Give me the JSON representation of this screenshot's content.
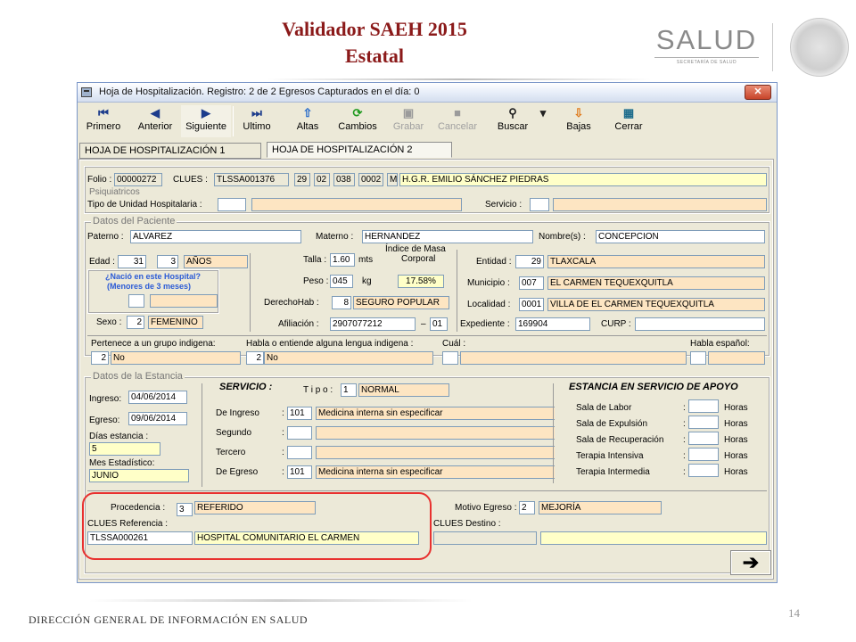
{
  "slide": {
    "title_line1": "Validador SAEH 2015",
    "title_line2": "Estatal",
    "logo_text": "SALUD",
    "logo_subtitle": "SECRETARÍA DE SALUD",
    "footer": "DIRECCIÓN GENERAL DE INFORMACIÓN EN SALUD",
    "page_number": "14"
  },
  "window": {
    "title": "Hoja de Hospitalización. Registro: 2 de 2    Egresos Capturados en el día: 0",
    "close_glyph": "✕"
  },
  "toolbar": [
    {
      "label": "Primero",
      "glyph": "⏮",
      "enabled": true
    },
    {
      "label": "Anterior",
      "glyph": "◀",
      "enabled": true
    },
    {
      "label": "Siguiente",
      "glyph": "▶",
      "enabled": true
    },
    {
      "label": "Ultimo",
      "glyph": "⏭",
      "enabled": true
    },
    {
      "label": "Altas",
      "glyph": "⇧",
      "enabled": true
    },
    {
      "label": "Cambios",
      "glyph": "⟳",
      "enabled": true
    },
    {
      "label": "Grabar",
      "glyph": "▣",
      "enabled": false
    },
    {
      "label": "Cancelar",
      "glyph": "■",
      "enabled": false
    },
    {
      "label": "Buscar",
      "glyph": "⚲",
      "enabled": true
    },
    {
      "label": "Bajas",
      "glyph": "⇩",
      "enabled": true
    },
    {
      "label": "Cerrar",
      "glyph": "▦",
      "enabled": true
    }
  ],
  "toolbar_dropdown": "▾",
  "tabs": [
    "HOJA DE HOSPITALIZACIÓN 1",
    "HOJA DE HOSPITALIZACIÓN 2"
  ],
  "form": {
    "folio_label": "Folio :",
    "folio": "00000272",
    "clues_label": "CLUES :",
    "clues": "TLSSA001376",
    "d1": "29",
    "d2": "02",
    "d3": "038",
    "d4": "0002",
    "d5": "M",
    "hospital": "H.G.R. EMILIO SÁNCHEZ PIEDRAS",
    "psiquiatricos": "Psiquiatricos",
    "tipo_unidad_label": "Tipo de Unidad Hospitalaria :",
    "servicio_label": "Servicio :",
    "datos_paciente": "Datos del Paciente",
    "paterno_label": "Paterno :",
    "paterno": "ALVAREZ",
    "materno_label": "Materno :",
    "materno": "HERNANDEZ",
    "nombres_label": "Nombre(s) :",
    "nombres": "CONCEPCION",
    "edad_label": "Edad :",
    "edad": "31",
    "edad_code": "3",
    "edad_unit": "AÑOS",
    "nacio_q1": "¿Nació en este Hospital?",
    "nacio_q2": "(Menores de 3 meses)",
    "sexo_label": "Sexo :",
    "sexo_code": "2",
    "sexo": "FEMENINO",
    "talla_label": "Talla :",
    "talla": "1.60",
    "talla_unit": "mts",
    "imc_label1": "Índice de Masa",
    "imc_label2": "Corporal",
    "imc": "17.58%",
    "peso_label": "Peso :",
    "peso": "045",
    "peso_unit": "kg",
    "derechohab_label": "DerechoHab :",
    "derechohab_code": "8",
    "derechohab": "SEGURO POPULAR",
    "afiliacion_label": "Afiliación :",
    "afiliacion": "2907077212",
    "afiliacion_sep": "–",
    "afiliacion_b": "01",
    "entidad_label": "Entidad :",
    "entidad_code": "29",
    "entidad": "TLAXCALA",
    "municipio_label": "Municipio :",
    "municipio_code": "007",
    "municipio": "EL CARMEN TEQUEXQUITLA",
    "localidad_label": "Localidad :",
    "localidad_code": "0001",
    "localidad": "VILLA DE EL CARMEN TEQUEXQUITLA",
    "expediente_label": "Expediente :",
    "expediente": "169904",
    "curp_label": "CURP :",
    "indigena_label": "Pertenece a un grupo indigena:",
    "indigena_code": "2",
    "indigena": "No",
    "lengua_label": "Habla o entiende alguna lengua indigena :",
    "lengua_code": "2",
    "lengua": "No",
    "cual_label": "Cuál :",
    "espanol_label": "Habla español:",
    "datos_estancia": "Datos de la Estancia",
    "ingreso_label": "Ingreso:",
    "ingreso": "04/06/2014",
    "egreso_label": "Egreso:",
    "egreso": "09/06/2014",
    "dias_label": "Días estancia :",
    "dias": "5",
    "mes_label": "Mes Estadístico:",
    "mes": "JUNIO",
    "servicio_title": "SERVICIO :",
    "tipo_label": "T i p o :",
    "tipo_code": "1",
    "tipo": "NORMAL",
    "de_ingreso_label": "De Ingreso",
    "de_ingreso_code": "101",
    "de_ingreso": "Medicina interna sin especificar",
    "segundo_label": "Segundo",
    "tercero_label": "Tercero",
    "de_egreso_label": "De Egreso",
    "de_egreso_code": "101",
    "de_egreso": "Medicina interna sin especificar",
    "colon": ":",
    "estancia_title": "ESTANCIA EN SERVICIO DE APOYO",
    "apoyo": [
      "Sala de Labor",
      "Sala de Expulsión",
      "Sala de Recuperación",
      "Terapia Intensiva",
      "Terapia Intermedia"
    ],
    "horas": "Horas",
    "procedencia_label": "Procedencia :",
    "procedencia_code": "3",
    "procedencia": "REFERIDO",
    "motivo_label": "Motivo Egreso :",
    "motivo_code": "2",
    "motivo": "MEJORÍA",
    "clues_ref_label": "CLUES Referencia :",
    "clues_ref": "TLSSA000261",
    "clues_ref_name": "HOSPITAL COMUNITARIO EL CARMEN",
    "clues_dest_label": "CLUES Destino :",
    "next_glyph": "➔"
  }
}
